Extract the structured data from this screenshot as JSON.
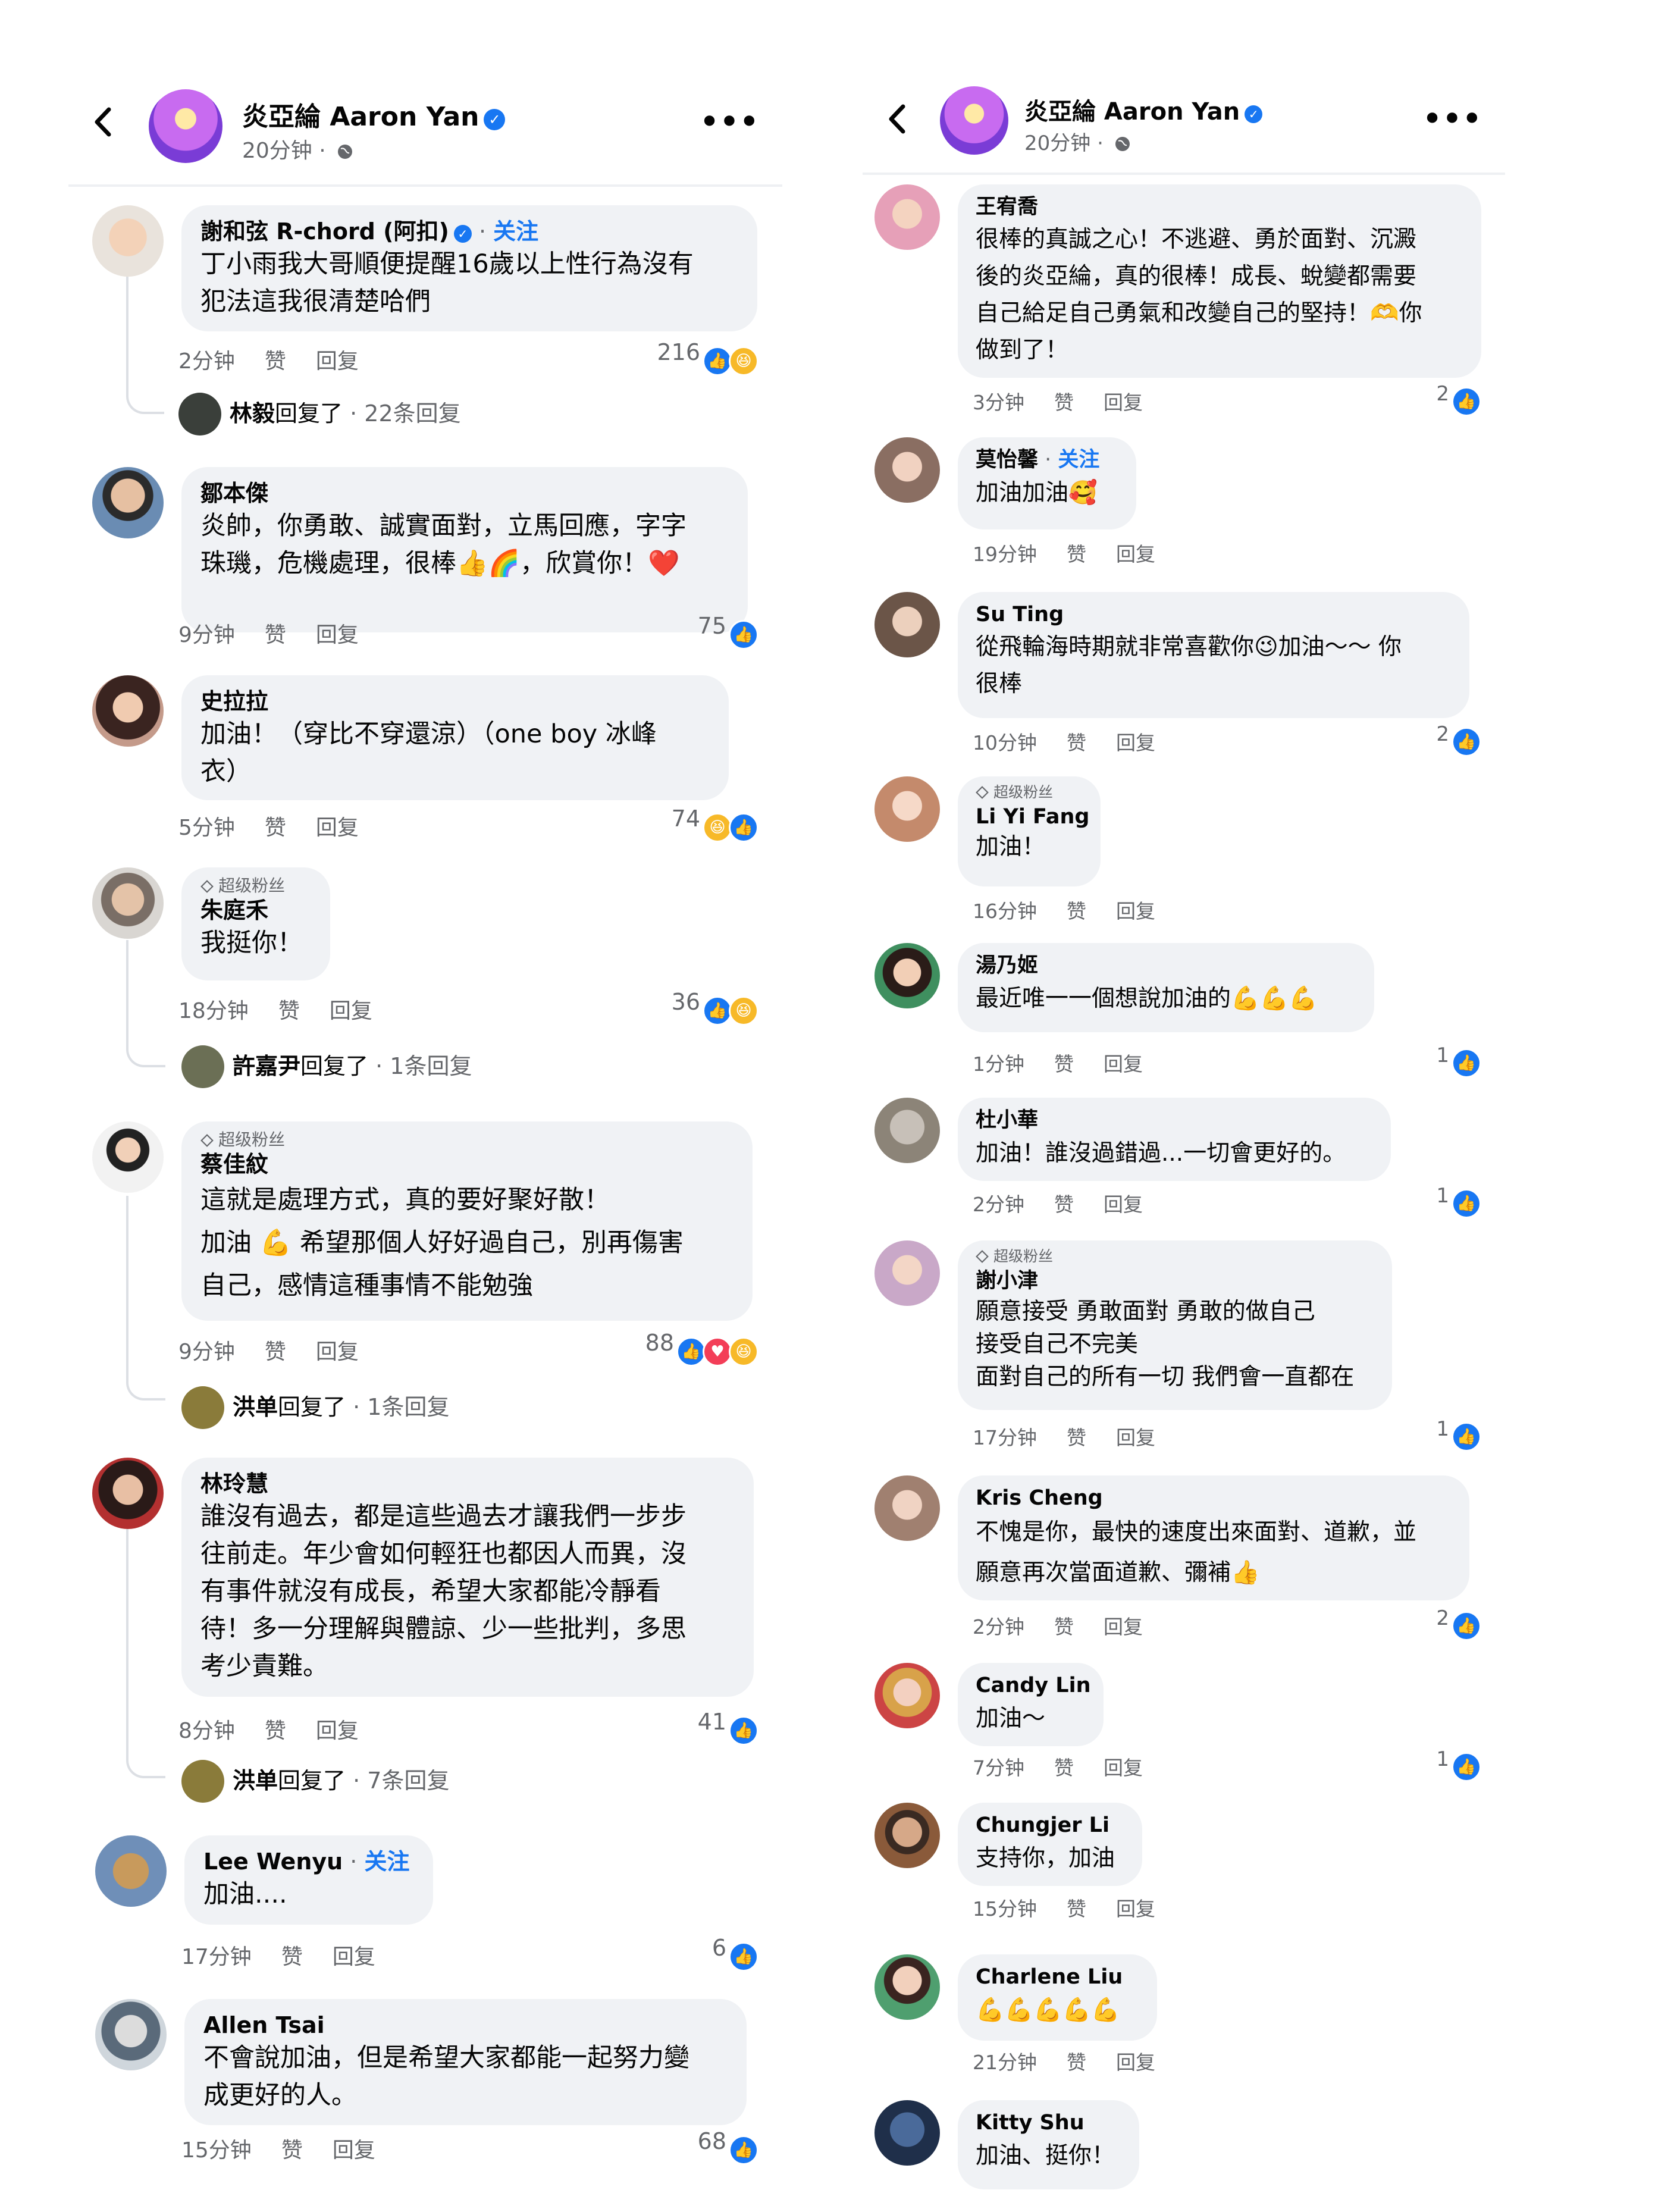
{
  "left": {
    "header": {
      "name": "炎亞綸 Aaron Yan",
      "time": "20分钟 · "
    },
    "comments": [
      {
        "author": "謝和弦 R-chord (阿扣)",
        "verified": true,
        "follow": "关注",
        "text": "丁小雨我大哥順便提醒16歲以上性行為沒有\n犯法這我很清楚哈們",
        "time": "2分钟",
        "like": "赞",
        "reply": "回复",
        "count": "216",
        "reactions": [
          "like",
          "haha"
        ],
        "replies": {
          "name": "林毅",
          "action": "回复了",
          "count": " · 22条回复"
        }
      },
      {
        "author": "鄒本傑",
        "text": "炎帥，你勇敢、誠實面對，立馬回應，字字\n珠璣，危機處理，很棒👍🌈，欣賞你！❤️",
        "time": "9分钟",
        "like": "赞",
        "reply": "回复",
        "count": "75",
        "reactions": [
          "like"
        ]
      },
      {
        "author": "史拉拉",
        "text": "加油！（穿比不穿還涼）（one boy 冰峰\n衣）",
        "time": "5分钟",
        "like": "赞",
        "reply": "回复",
        "count": "74",
        "reactions": [
          "haha",
          "like"
        ]
      },
      {
        "badge": "超级粉丝",
        "author": "朱庭禾",
        "text": "我挺你！",
        "time": "18分钟",
        "like": "赞",
        "reply": "回复",
        "count": "36",
        "reactions": [
          "like",
          "haha"
        ],
        "replies": {
          "name": "許嘉尹",
          "action": "回复了",
          "count": " · 1条回复"
        }
      },
      {
        "badge": "超级粉丝",
        "author": "蔡佳紋",
        "text": "這就是處理方式，真的要好聚好散！\n加油 💪 希望那個人好好過自己，別再傷害\n自己，感情這種事情不能勉強",
        "time": "9分钟",
        "like": "赞",
        "reply": "回复",
        "count": "88",
        "reactions": [
          "like",
          "love",
          "haha"
        ],
        "replies": {
          "name": "洪单",
          "action": "回复了",
          "count": " · 1条回复"
        }
      },
      {
        "author": "林玲慧",
        "text": "誰沒有過去，都是這些過去才讓我們一步步\n往前走。年少會如何輕狂也都因人而異，沒\n有事件就沒有成長，希望大家都能冷靜看\n待！多一分理解與體諒、少一些批判，多思\n考少責難。",
        "time": "8分钟",
        "like": "赞",
        "reply": "回复",
        "count": "41",
        "reactions": [
          "like"
        ],
        "replies": {
          "name": "洪单",
          "action": "回复了",
          "count": " · 7条回复"
        }
      },
      {
        "author": "Lee Wenyu",
        "follow": "关注",
        "text": "加油....",
        "time": "17分钟",
        "like": "赞",
        "reply": "回复",
        "count": "6",
        "reactions": [
          "like"
        ]
      },
      {
        "author": "Allen Tsai",
        "text": "不會說加油，但是希望大家都能一起努力變\n成更好的人。",
        "time": "15分钟",
        "like": "赞",
        "reply": "回复",
        "count": "68",
        "reactions": [
          "like"
        ]
      }
    ]
  },
  "right": {
    "header": {
      "name": "炎亞綸 Aaron Yan",
      "time": "20分钟 · "
    },
    "comments": [
      {
        "author": "王宥喬",
        "text": "很棒的真誠之心！不逃避、勇於面對、沉澱\n後的炎亞綸，真的很棒！成長、蛻變都需要\n自己給足自己勇氣和改變自己的堅持！🫶你\n做到了！",
        "time": "3分钟",
        "like": "赞",
        "reply": "回复",
        "count": "2",
        "reactions": [
          "like"
        ]
      },
      {
        "author": "莫怡馨",
        "follow": "关注",
        "text": "加油加油🥰",
        "time": "19分钟",
        "like": "赞",
        "reply": "回复",
        "count": "",
        "reactions": []
      },
      {
        "author": "Su Ting",
        "text": "從飛輪海時期就非常喜歡你😉加油～～ 你\n很棒",
        "time": "10分钟",
        "like": "赞",
        "reply": "回复",
        "count": "2",
        "reactions": [
          "like"
        ]
      },
      {
        "badge": "超级粉丝",
        "author": "Li Yi Fang",
        "text": "加油！",
        "time": "16分钟",
        "like": "赞",
        "reply": "回复",
        "count": "",
        "reactions": []
      },
      {
        "author": "湯乃姬",
        "text": "最近唯一一個想說加油的💪💪💪",
        "time": "1分钟",
        "like": "赞",
        "reply": "回复",
        "count": "1",
        "reactions": [
          "like"
        ]
      },
      {
        "author": "杜小華",
        "text": "加油！誰沒過錯過...一切會更好的。",
        "time": "2分钟",
        "like": "赞",
        "reply": "回复",
        "count": "1",
        "reactions": [
          "like"
        ]
      },
      {
        "badge": "超级粉丝",
        "author": "謝小津",
        "text": "願意接受 勇敢面對 勇敢的做自己\n接受自己不完美\n面對自己的所有一切 我們會一直都在",
        "time": "17分钟",
        "like": "赞",
        "reply": "回复",
        "count": "1",
        "reactions": [
          "like"
        ]
      },
      {
        "author": "Kris Cheng",
        "text": "不愧是你，最快的速度出來面對、道歉，並\n願意再次當面道歉、彌補👍",
        "time": "2分钟",
        "like": "赞",
        "reply": "回复",
        "count": "2",
        "reactions": [
          "like"
        ]
      },
      {
        "author": "Candy Lin",
        "text": "加油～",
        "time": "7分钟",
        "like": "赞",
        "reply": "回复",
        "count": "1",
        "reactions": [
          "like"
        ]
      },
      {
        "author": "Chungjer Li",
        "text": "支持你，加油",
        "time": "15分钟",
        "like": "赞",
        "reply": "回复",
        "count": "",
        "reactions": []
      },
      {
        "author": "Charlene Liu",
        "text": "💪💪💪💪💪",
        "time": "21分钟",
        "like": "赞",
        "reply": "回复",
        "count": "",
        "reactions": []
      },
      {
        "author": "Kitty Shu",
        "text": "加油、挺你！",
        "time": "",
        "like": "",
        "reply": "",
        "count": "",
        "reactions": []
      }
    ]
  },
  "colors": {
    "accent": "#1877f2",
    "bubble": "#f0f2f5",
    "meta": "#65676b",
    "haha": "#f7b928",
    "love": "#f33e58"
  },
  "icons": {
    "back": "chevron-left-icon",
    "globe": "globe-icon",
    "more": "more-dots-icon",
    "verified": "verified-badge-icon",
    "like": "like-reaction-icon",
    "haha": "haha-reaction-icon",
    "love": "love-reaction-icon",
    "superfan": "diamond-icon"
  }
}
